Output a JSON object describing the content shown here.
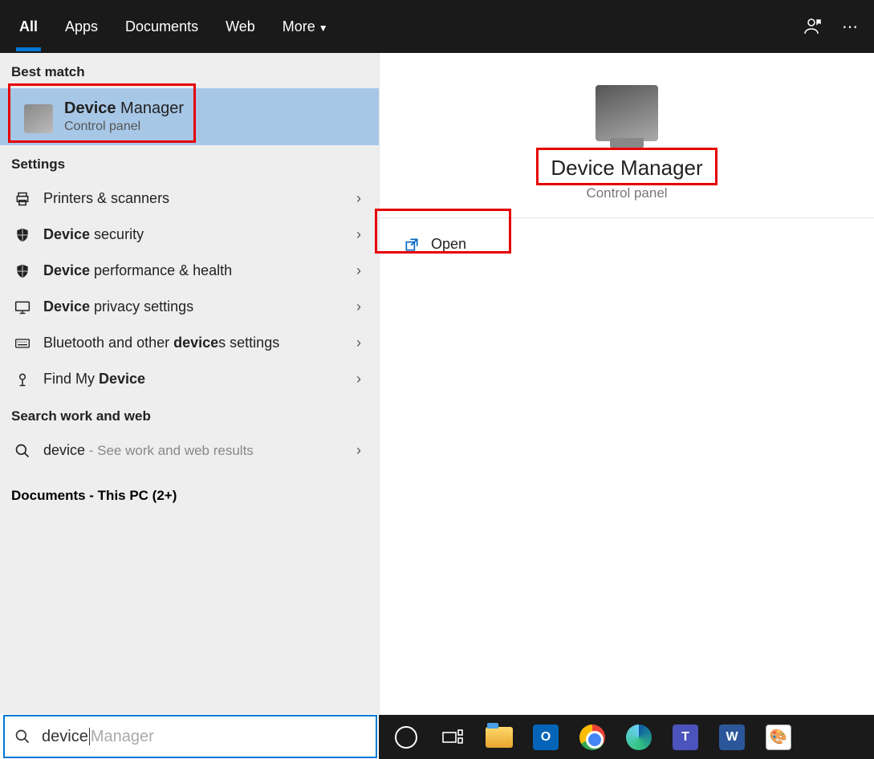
{
  "topbar": {
    "tabs": [
      "All",
      "Apps",
      "Documents",
      "Web",
      "More"
    ],
    "active_index": 0
  },
  "left": {
    "best_match_label": "Best match",
    "best_match": {
      "title_bold": "Device",
      "title_rest": " Manager",
      "subtitle": "Control panel"
    },
    "settings_label": "Settings",
    "settings": [
      {
        "icon": "printer",
        "pre": "",
        "bold": "",
        "text": "Printers & scanners"
      },
      {
        "icon": "shield",
        "pre": "",
        "bold": "Device",
        "text": " security"
      },
      {
        "icon": "shield",
        "pre": "",
        "bold": "Device",
        "text": " performance & health"
      },
      {
        "icon": "monitor",
        "pre": "",
        "bold": "Device",
        "text": " privacy settings"
      },
      {
        "icon": "keyboard",
        "pre": "Bluetooth and other ",
        "bold": "device",
        "text": "s settings"
      },
      {
        "icon": "pin",
        "pre": "Find My ",
        "bold": "Device",
        "text": ""
      }
    ],
    "search_web_label": "Search work and web",
    "web_result": {
      "term": "device",
      "suffix": " - See work and web results"
    },
    "documents_label": "Documents - This PC (2+)"
  },
  "right": {
    "title": "Device Manager",
    "subtitle": "Control panel",
    "action": "Open"
  },
  "search": {
    "typed": "device",
    "ghost": " Manager"
  },
  "taskbar": {
    "items": [
      "cortana",
      "taskview",
      "explorer",
      "outlook",
      "chrome",
      "edge",
      "teams",
      "word",
      "paint"
    ]
  }
}
